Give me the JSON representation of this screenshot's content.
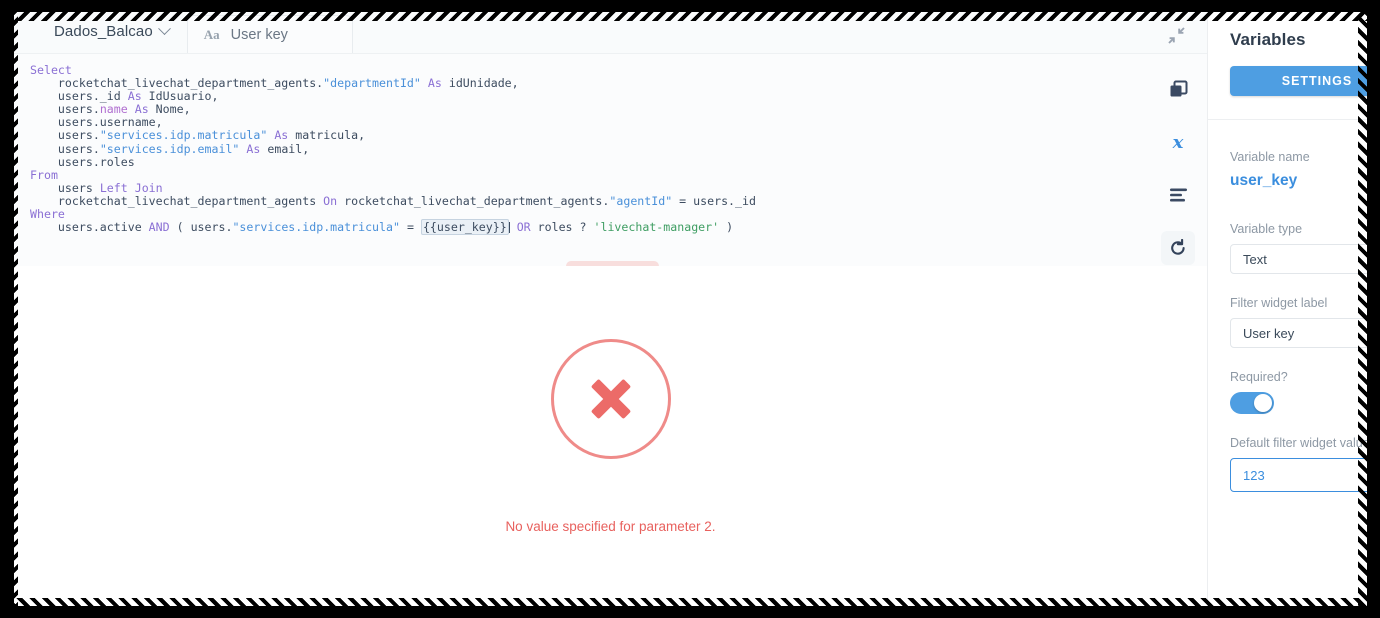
{
  "editor": {
    "database_selector": "Dados_Balcao",
    "tab": {
      "type_icon": "Aa",
      "label": "User key"
    },
    "collapse_icon": "collapse-arrows-icon",
    "rail_icons": [
      {
        "name": "duplicate-icon"
      },
      {
        "name": "variables-x-icon"
      },
      {
        "name": "format-lines-icon"
      },
      {
        "name": "refresh-icon"
      }
    ],
    "sql_lines": [
      [
        {
          "t": "Select",
          "c": "kw"
        }
      ],
      [
        {
          "t": "    rocketchat_livechat_department_agents.",
          "c": ""
        },
        {
          "t": "\"departmentId\"",
          "c": "qid"
        },
        {
          "t": " ",
          "c": ""
        },
        {
          "t": "As",
          "c": "kw"
        },
        {
          "t": " idUnidade,",
          "c": ""
        }
      ],
      [
        {
          "t": "    users._id ",
          "c": ""
        },
        {
          "t": "As",
          "c": "kw"
        },
        {
          "t": " IdUsuario,",
          "c": ""
        }
      ],
      [
        {
          "t": "    users.",
          "c": ""
        },
        {
          "t": "name",
          "c": "fn"
        },
        {
          "t": " ",
          "c": ""
        },
        {
          "t": "As",
          "c": "kw"
        },
        {
          "t": " Nome,",
          "c": ""
        }
      ],
      [
        {
          "t": "    users.username,",
          "c": ""
        }
      ],
      [
        {
          "t": "    users.",
          "c": ""
        },
        {
          "t": "\"services.idp.matricula\"",
          "c": "qid"
        },
        {
          "t": " ",
          "c": ""
        },
        {
          "t": "As",
          "c": "kw"
        },
        {
          "t": " matricula,",
          "c": ""
        }
      ],
      [
        {
          "t": "    users.",
          "c": ""
        },
        {
          "t": "\"services.idp.email\"",
          "c": "qid"
        },
        {
          "t": " ",
          "c": ""
        },
        {
          "t": "As",
          "c": "kw"
        },
        {
          "t": " email,",
          "c": ""
        }
      ],
      [
        {
          "t": "    users.roles",
          "c": ""
        }
      ],
      [
        {
          "t": "From",
          "c": "kw"
        }
      ],
      [
        {
          "t": "    users ",
          "c": ""
        },
        {
          "t": "Left Join",
          "c": "kw"
        }
      ],
      [
        {
          "t": "    rocketchat_livechat_department_agents ",
          "c": ""
        },
        {
          "t": "On",
          "c": "kw"
        },
        {
          "t": " rocketchat_livechat_department_agents.",
          "c": ""
        },
        {
          "t": "\"agentId\"",
          "c": "qid"
        },
        {
          "t": " = users._id",
          "c": ""
        }
      ],
      [
        {
          "t": "Where",
          "c": "kw"
        }
      ],
      [
        {
          "t": "    users.active ",
          "c": ""
        },
        {
          "t": "AND",
          "c": "kw"
        },
        {
          "t": " ( users.",
          "c": ""
        },
        {
          "t": "\"services.idp.matricula\"",
          "c": "qid"
        },
        {
          "t": " = ",
          "c": ""
        },
        {
          "t": "{{user_key}}",
          "c": "chip"
        },
        {
          "t": "CARET",
          "c": "caret"
        },
        {
          "t": " ",
          "c": ""
        },
        {
          "t": "OR",
          "c": "kw"
        },
        {
          "t": " roles ? ",
          "c": ""
        },
        {
          "t": "'livechat-manager'",
          "c": "str"
        },
        {
          "t": " )",
          "c": ""
        }
      ]
    ]
  },
  "result": {
    "error_icon": "error-x-circle-icon",
    "error_message": "No value specified for parameter 2."
  },
  "variables_panel": {
    "title": "Variables",
    "settings_button": "SETTINGS",
    "fields": {
      "variable_name_label": "Variable name",
      "variable_name_value": "user_key",
      "variable_type_label": "Variable type",
      "variable_type_value": "Text",
      "filter_widget_label_label": "Filter widget label",
      "filter_widget_label_value": "User key",
      "required_label": "Required?",
      "required_on": true,
      "default_value_label": "Default filter widget value",
      "default_value_value": "123"
    }
  },
  "colors": {
    "accent_blue": "#4e9ee2",
    "error_red": "#e8615e",
    "keyword_purple": "#8a6fd4",
    "string_green": "#3f9e63",
    "quoted_id_blue": "#4a90d9"
  }
}
